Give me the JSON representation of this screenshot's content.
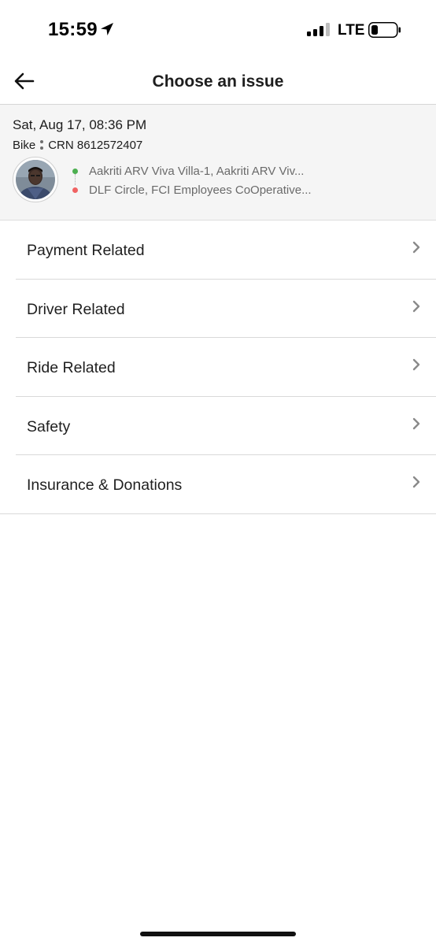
{
  "status_bar": {
    "time": "15:59",
    "network": "LTE",
    "icons": [
      "location-arrow-icon",
      "signal-icon",
      "battery-icon"
    ]
  },
  "header": {
    "title": "Choose an issue",
    "back_icon": "arrow-left-icon"
  },
  "ride": {
    "datetime": "Sat, Aug 17, 08:36 PM",
    "vehicle": "Bike",
    "crn": "CRN 8612572407",
    "pickup": "Aakriti ARV Viva Villa-1, Aakriti ARV Viv...",
    "drop": "DLF Circle, FCI Employees CoOperative...",
    "pickup_color": "#4caf50",
    "drop_color": "#f06262"
  },
  "issues": [
    {
      "label": "Payment Related"
    },
    {
      "label": "Driver Related"
    },
    {
      "label": "Ride Related"
    },
    {
      "label": "Safety"
    },
    {
      "label": "Insurance & Donations"
    }
  ],
  "colors": {
    "card_background": "#f5f5f5",
    "divider": "#d9d9d9",
    "chevron": "#8a8a8a"
  }
}
